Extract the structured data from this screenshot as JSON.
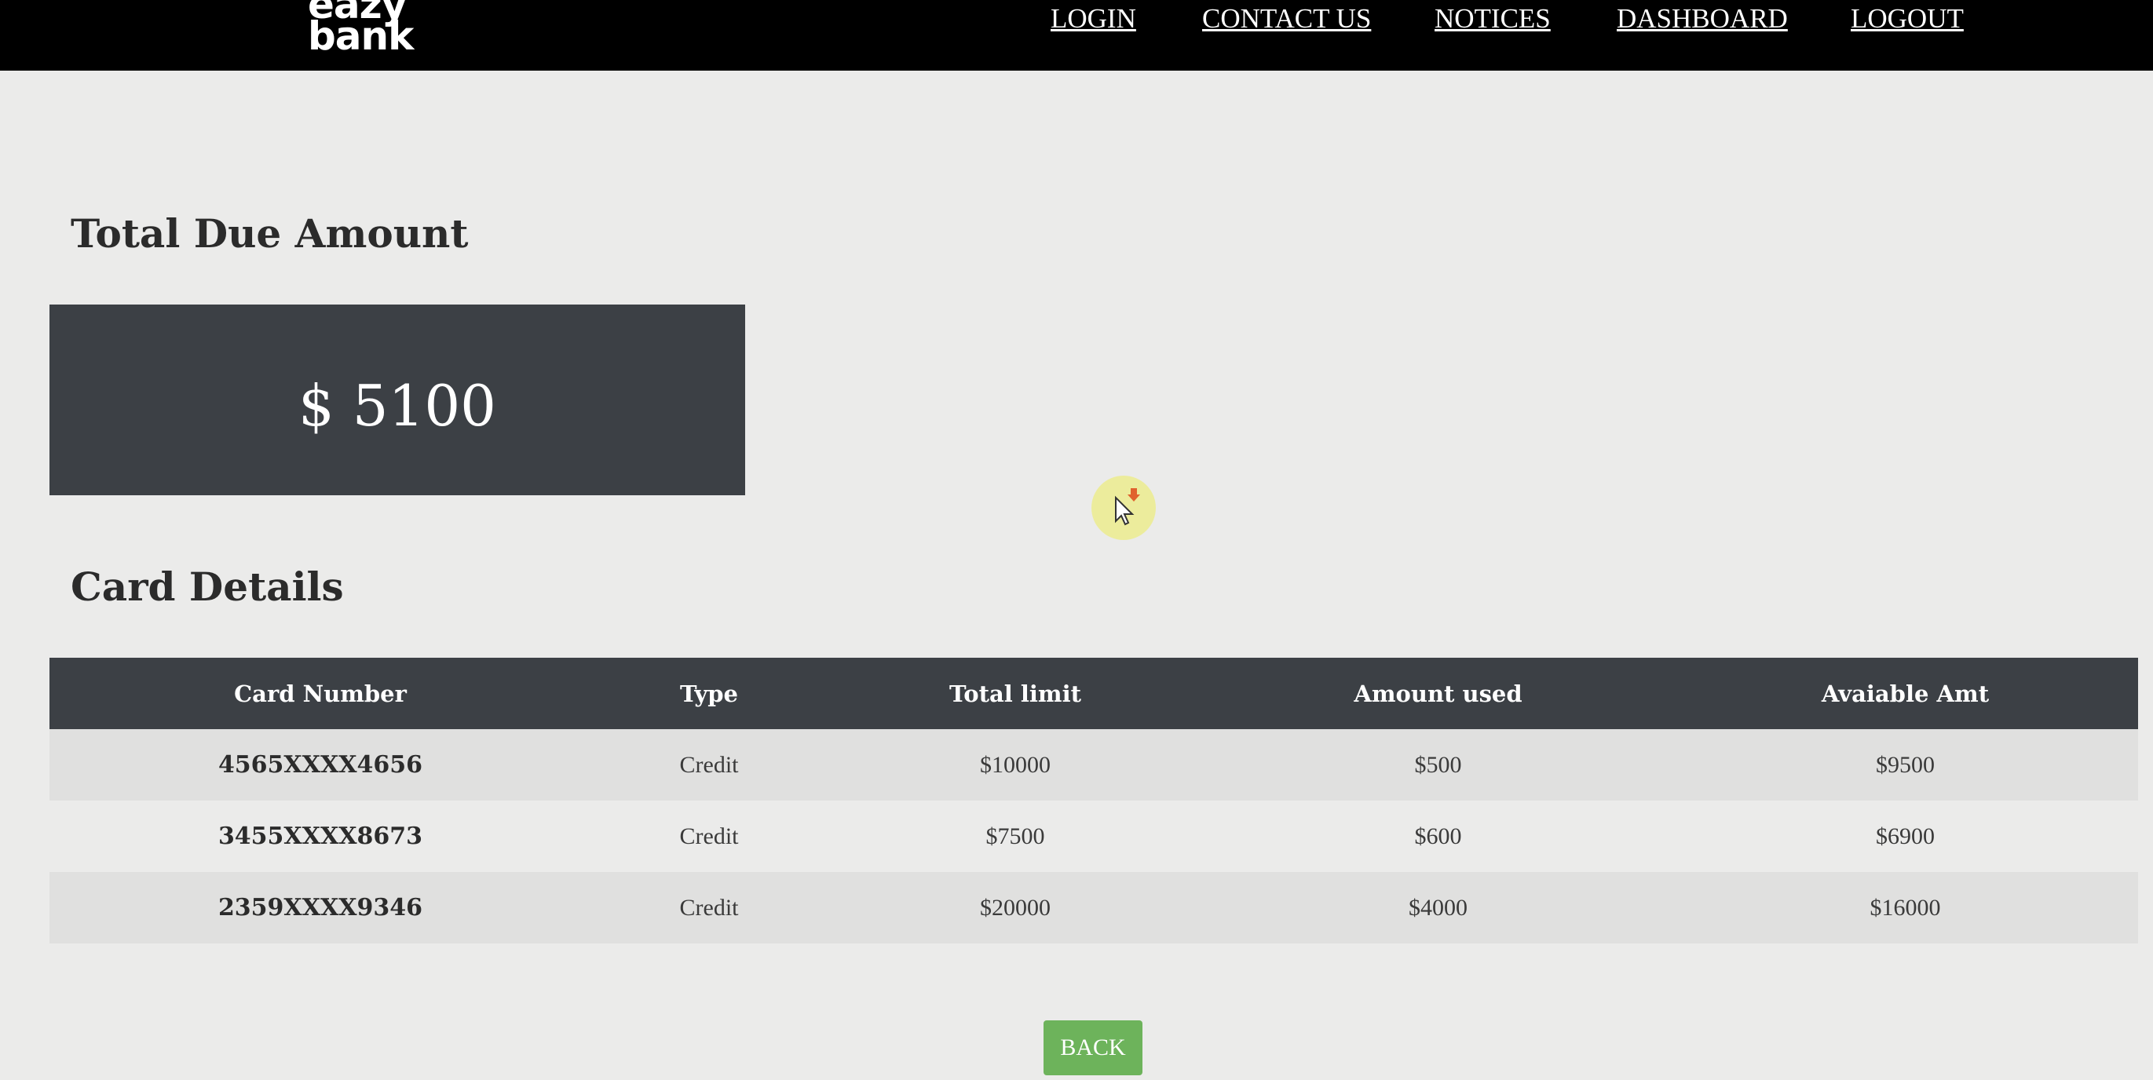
{
  "header": {
    "logo_line1": "eazy",
    "logo_line2": "bank",
    "nav": {
      "login": "LOGIN",
      "contact": "CONTACT US",
      "notices": "NOTICES",
      "dashboard": "DASHBOARD",
      "logout": "LOGOUT"
    }
  },
  "due": {
    "title": "Total Due Amount",
    "amount": "$ 5100"
  },
  "cards": {
    "title": "Card Details",
    "columns": [
      "Card Number",
      "Type",
      "Total limit",
      "Amount used",
      "Avaiable Amt"
    ],
    "rows": [
      {
        "number": "4565XXXX4656",
        "type": "Credit",
        "limit": "$10000",
        "used": "$500",
        "available": "$9500"
      },
      {
        "number": "3455XXXX8673",
        "type": "Credit",
        "limit": "$7500",
        "used": "$600",
        "available": "$6900"
      },
      {
        "number": "2359XXXX9346",
        "type": "Credit",
        "limit": "$20000",
        "used": "$4000",
        "available": "$16000"
      }
    ]
  },
  "actions": {
    "back": "BACK"
  },
  "colors": {
    "header_bg": "#000000",
    "panel_bg": "#3c4045",
    "button_bg": "#6db35b",
    "page_bg": "#ebebea"
  },
  "icons": {
    "cursor": "mouse-pointer-icon"
  }
}
